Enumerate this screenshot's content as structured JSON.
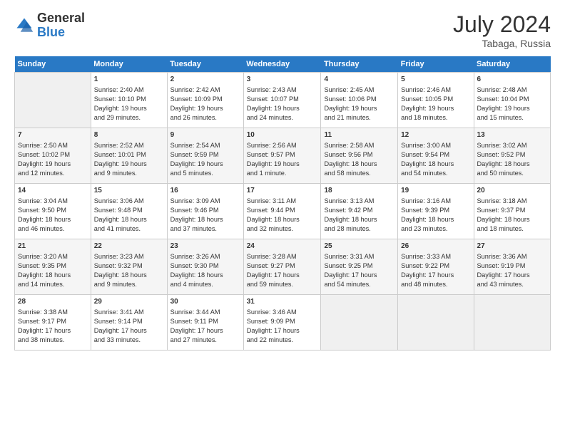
{
  "header": {
    "logo_general": "General",
    "logo_blue": "Blue",
    "title": "July 2024",
    "location": "Tabaga, Russia"
  },
  "days_of_week": [
    "Sunday",
    "Monday",
    "Tuesday",
    "Wednesday",
    "Thursday",
    "Friday",
    "Saturday"
  ],
  "weeks": [
    [
      {
        "num": "",
        "data": ""
      },
      {
        "num": "1",
        "data": "Sunrise: 2:40 AM\nSunset: 10:10 PM\nDaylight: 19 hours\nand 29 minutes."
      },
      {
        "num": "2",
        "data": "Sunrise: 2:42 AM\nSunset: 10:09 PM\nDaylight: 19 hours\nand 26 minutes."
      },
      {
        "num": "3",
        "data": "Sunrise: 2:43 AM\nSunset: 10:07 PM\nDaylight: 19 hours\nand 24 minutes."
      },
      {
        "num": "4",
        "data": "Sunrise: 2:45 AM\nSunset: 10:06 PM\nDaylight: 19 hours\nand 21 minutes."
      },
      {
        "num": "5",
        "data": "Sunrise: 2:46 AM\nSunset: 10:05 PM\nDaylight: 19 hours\nand 18 minutes."
      },
      {
        "num": "6",
        "data": "Sunrise: 2:48 AM\nSunset: 10:04 PM\nDaylight: 19 hours\nand 15 minutes."
      }
    ],
    [
      {
        "num": "7",
        "data": "Sunrise: 2:50 AM\nSunset: 10:02 PM\nDaylight: 19 hours\nand 12 minutes."
      },
      {
        "num": "8",
        "data": "Sunrise: 2:52 AM\nSunset: 10:01 PM\nDaylight: 19 hours\nand 9 minutes."
      },
      {
        "num": "9",
        "data": "Sunrise: 2:54 AM\nSunset: 9:59 PM\nDaylight: 19 hours\nand 5 minutes."
      },
      {
        "num": "10",
        "data": "Sunrise: 2:56 AM\nSunset: 9:57 PM\nDaylight: 19 hours\nand 1 minute."
      },
      {
        "num": "11",
        "data": "Sunrise: 2:58 AM\nSunset: 9:56 PM\nDaylight: 18 hours\nand 58 minutes."
      },
      {
        "num": "12",
        "data": "Sunrise: 3:00 AM\nSunset: 9:54 PM\nDaylight: 18 hours\nand 54 minutes."
      },
      {
        "num": "13",
        "data": "Sunrise: 3:02 AM\nSunset: 9:52 PM\nDaylight: 18 hours\nand 50 minutes."
      }
    ],
    [
      {
        "num": "14",
        "data": "Sunrise: 3:04 AM\nSunset: 9:50 PM\nDaylight: 18 hours\nand 46 minutes."
      },
      {
        "num": "15",
        "data": "Sunrise: 3:06 AM\nSunset: 9:48 PM\nDaylight: 18 hours\nand 41 minutes."
      },
      {
        "num": "16",
        "data": "Sunrise: 3:09 AM\nSunset: 9:46 PM\nDaylight: 18 hours\nand 37 minutes."
      },
      {
        "num": "17",
        "data": "Sunrise: 3:11 AM\nSunset: 9:44 PM\nDaylight: 18 hours\nand 32 minutes."
      },
      {
        "num": "18",
        "data": "Sunrise: 3:13 AM\nSunset: 9:42 PM\nDaylight: 18 hours\nand 28 minutes."
      },
      {
        "num": "19",
        "data": "Sunrise: 3:16 AM\nSunset: 9:39 PM\nDaylight: 18 hours\nand 23 minutes."
      },
      {
        "num": "20",
        "data": "Sunrise: 3:18 AM\nSunset: 9:37 PM\nDaylight: 18 hours\nand 18 minutes."
      }
    ],
    [
      {
        "num": "21",
        "data": "Sunrise: 3:20 AM\nSunset: 9:35 PM\nDaylight: 18 hours\nand 14 minutes."
      },
      {
        "num": "22",
        "data": "Sunrise: 3:23 AM\nSunset: 9:32 PM\nDaylight: 18 hours\nand 9 minutes."
      },
      {
        "num": "23",
        "data": "Sunrise: 3:26 AM\nSunset: 9:30 PM\nDaylight: 18 hours\nand 4 minutes."
      },
      {
        "num": "24",
        "data": "Sunrise: 3:28 AM\nSunset: 9:27 PM\nDaylight: 17 hours\nand 59 minutes."
      },
      {
        "num": "25",
        "data": "Sunrise: 3:31 AM\nSunset: 9:25 PM\nDaylight: 17 hours\nand 54 minutes."
      },
      {
        "num": "26",
        "data": "Sunrise: 3:33 AM\nSunset: 9:22 PM\nDaylight: 17 hours\nand 48 minutes."
      },
      {
        "num": "27",
        "data": "Sunrise: 3:36 AM\nSunset: 9:19 PM\nDaylight: 17 hours\nand 43 minutes."
      }
    ],
    [
      {
        "num": "28",
        "data": "Sunrise: 3:38 AM\nSunset: 9:17 PM\nDaylight: 17 hours\nand 38 minutes."
      },
      {
        "num": "29",
        "data": "Sunrise: 3:41 AM\nSunset: 9:14 PM\nDaylight: 17 hours\nand 33 minutes."
      },
      {
        "num": "30",
        "data": "Sunrise: 3:44 AM\nSunset: 9:11 PM\nDaylight: 17 hours\nand 27 minutes."
      },
      {
        "num": "31",
        "data": "Sunrise: 3:46 AM\nSunset: 9:09 PM\nDaylight: 17 hours\nand 22 minutes."
      },
      {
        "num": "",
        "data": ""
      },
      {
        "num": "",
        "data": ""
      },
      {
        "num": "",
        "data": ""
      }
    ]
  ]
}
